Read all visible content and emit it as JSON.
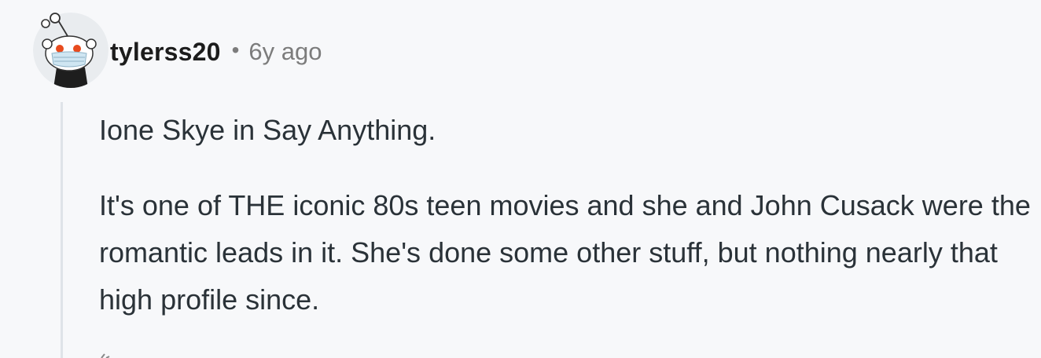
{
  "comment": {
    "author": "tylerss20",
    "separator": "•",
    "timestamp": "6y ago",
    "avatar_icon": "snoo-avatar-icon",
    "paragraphs": [
      "Ione Skye in Say Anything.",
      "It's one of THE iconic 80s teen movies and she and John Cusack were the romantic leads in it. She's done some other stuff, but nothing nearly that high profile since."
    ]
  },
  "colors": {
    "background": "#f7f8fa",
    "username": "#1c1c1c",
    "meta_text": "#7c7c7c",
    "body_text": "#2a3238",
    "thread_line": "#dfe3e8"
  }
}
